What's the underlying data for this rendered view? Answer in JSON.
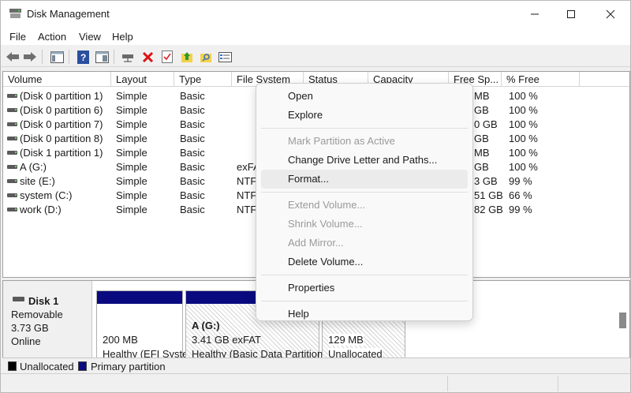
{
  "window": {
    "title": "Disk Management"
  },
  "menu": [
    "File",
    "Action",
    "View",
    "Help"
  ],
  "toolbar_icons": [
    "back-arrow-icon",
    "forward-arrow-icon",
    "console-tree-icon",
    "help-icon",
    "properties-pane-icon",
    "connect-drive-icon",
    "delete-icon",
    "check-icon",
    "up-folder-icon",
    "search-folder-icon",
    "list-view-icon"
  ],
  "list": {
    "columns": [
      "Volume",
      "Layout",
      "Type",
      "File System",
      "Status",
      "Capacity",
      "Free Sp...",
      "% Free"
    ],
    "rows": [
      {
        "volume": "(Disk 0 partition 1)",
        "layout": "Simple",
        "type": "Basic",
        "fs": "",
        "free": "MB",
        "pct": "100 %"
      },
      {
        "volume": "(Disk 0 partition 6)",
        "layout": "Simple",
        "type": "Basic",
        "fs": "",
        "free": "GB",
        "pct": "100 %"
      },
      {
        "volume": "(Disk 0 partition 7)",
        "layout": "Simple",
        "type": "Basic",
        "fs": "",
        "free": "0 GB",
        "pct": "100 %"
      },
      {
        "volume": "(Disk 0 partition 8)",
        "layout": "Simple",
        "type": "Basic",
        "fs": "",
        "free": "GB",
        "pct": "100 %"
      },
      {
        "volume": "(Disk 1 partition 1)",
        "layout": "Simple",
        "type": "Basic",
        "fs": "",
        "free": "MB",
        "pct": "100 %"
      },
      {
        "volume": "A (G:)",
        "layout": "Simple",
        "type": "Basic",
        "fs": "exFA",
        "free": "GB",
        "pct": "100 %"
      },
      {
        "volume": "site (E:)",
        "layout": "Simple",
        "type": "Basic",
        "fs": "NTF",
        "free": "3 GB",
        "pct": "99 %"
      },
      {
        "volume": "system (C:)",
        "layout": "Simple",
        "type": "Basic",
        "fs": "NTF",
        "free": "51 GB",
        "pct": "66 %"
      },
      {
        "volume": "work (D:)",
        "layout": "Simple",
        "type": "Basic",
        "fs": "NTF",
        "free": "82 GB",
        "pct": "99 %"
      }
    ]
  },
  "disk": {
    "name": "Disk 1",
    "kind": "Removable",
    "size": "3.73 GB",
    "state": "Online",
    "partitions": [
      {
        "title": "",
        "size": "200 MB",
        "status": "Healthy (EFI Syste"
      },
      {
        "title": "A  (G:)",
        "size": "3.41 GB exFAT",
        "status": "Healthy (Basic Data Partition"
      },
      {
        "title": "",
        "size": "129 MB",
        "status": "Unallocated"
      }
    ]
  },
  "legend": {
    "unallocated": "Unallocated",
    "primary": "Primary partition"
  },
  "colors": {
    "primary": "#0a0a80",
    "unallocated": "#000000",
    "hover": "#ebebeb"
  },
  "context_menu": {
    "items": [
      {
        "label": "Open",
        "enabled": true
      },
      {
        "label": "Explore",
        "enabled": true
      },
      {
        "label": "Mark Partition as Active",
        "enabled": false
      },
      {
        "label": "Change Drive Letter and Paths...",
        "enabled": true
      },
      {
        "label": "Format...",
        "enabled": true,
        "hovered": true
      },
      {
        "label": "Extend Volume...",
        "enabled": false
      },
      {
        "label": "Shrink Volume...",
        "enabled": false
      },
      {
        "label": "Add Mirror...",
        "enabled": false
      },
      {
        "label": "Delete Volume...",
        "enabled": true
      },
      {
        "label": "Properties",
        "enabled": true
      },
      {
        "label": "Help",
        "enabled": true
      }
    ]
  }
}
